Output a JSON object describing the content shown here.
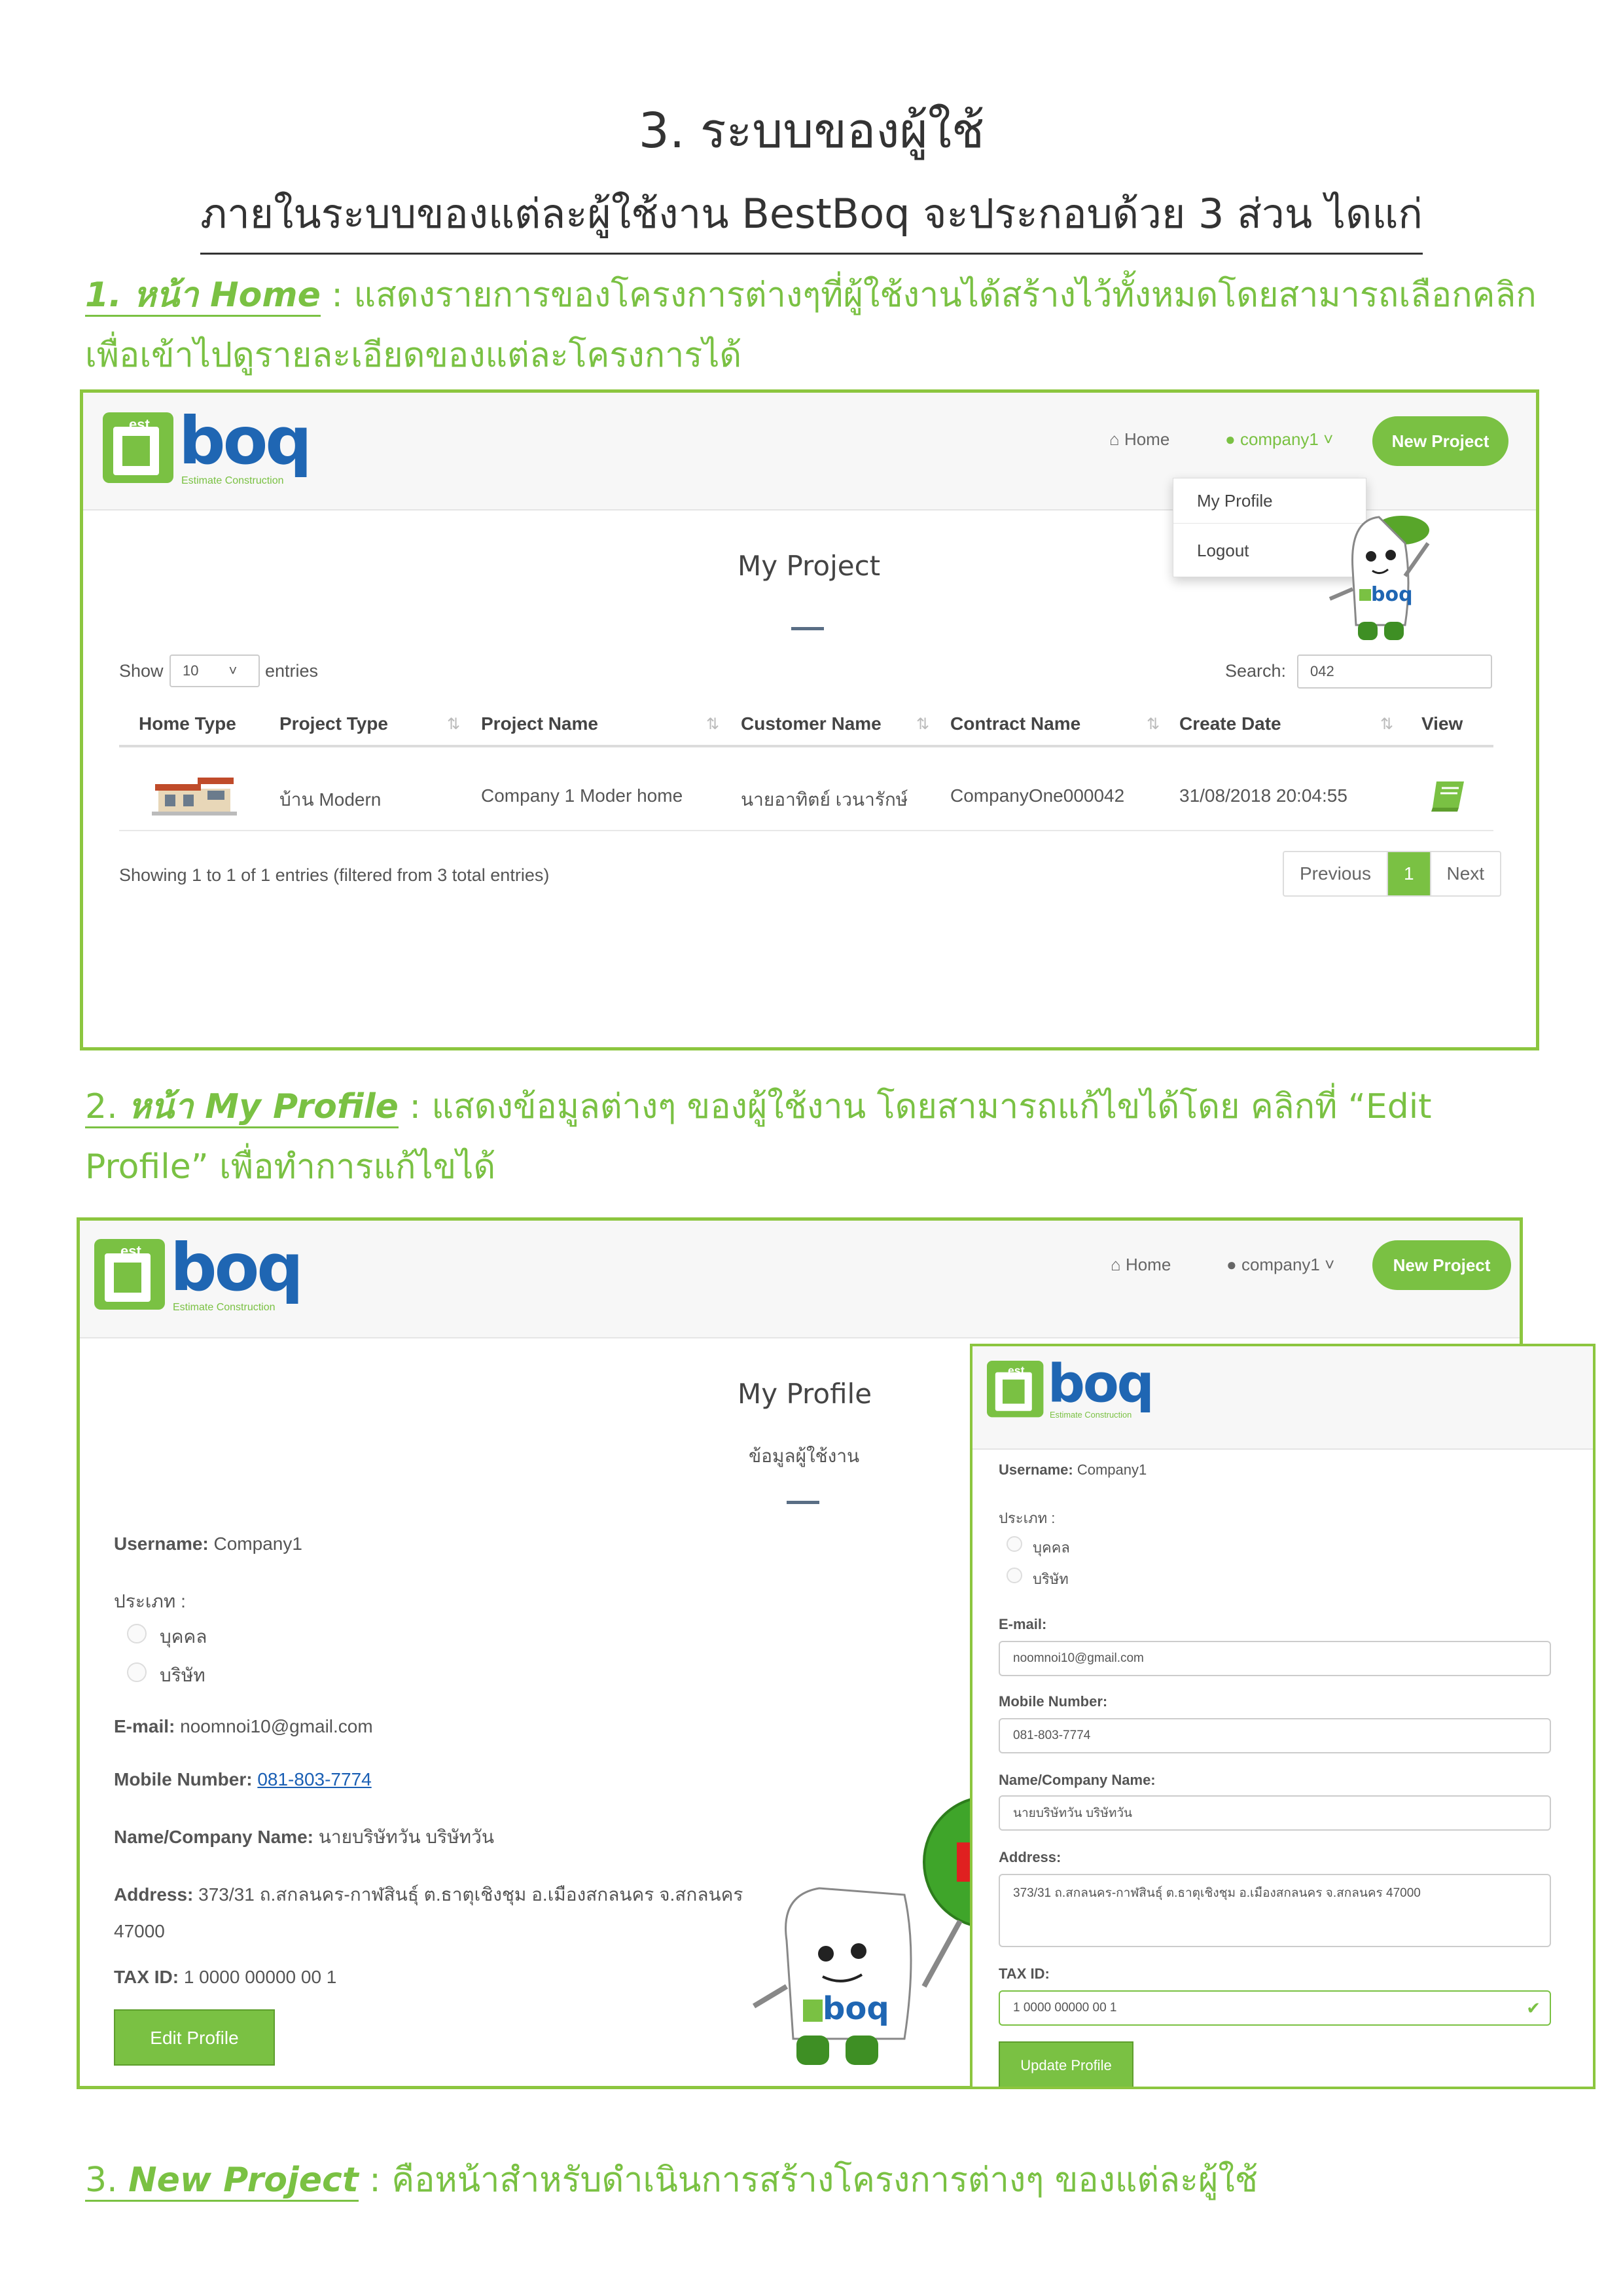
{
  "doc": {
    "title": "3. ระบบของผู้ใช้",
    "subtitle": "ภายในระบบของแต่ละผู้ใช้งาน BestBoq จะประกอบด้วย 3 ส่วน ไดแก่",
    "section1": {
      "lead": "1. หน้า Home",
      "text": " : แสดงรายการของโครงการต่างๆที่ผู้ใช้งานได้สร้างไว้ทั้งหมดโดยสามารถเลือกคลิกเพื่อเข้าไปดูรายละเอียดของแต่ละโครงการได้"
    },
    "section2": {
      "num": "2. ",
      "lead": "หน้า My Profile",
      "text": " : แสดงข้อมูลต่างๆ ของผู้ใช้งาน โดยสามารถแก้ไขได้โดย คลิกที่ “Edit Profile” เพื่อทำการแก้ไขได้"
    },
    "section3": {
      "num": "3. ",
      "lead": "New Project",
      "text": " : คือหน้าสำหรับดำเนินการสร้างโครงการต่างๆ ของแต่ละผู้ใช้"
    }
  },
  "brand": {
    "logo_text": "boq",
    "logo_est": "est",
    "logo_tagline": "Estimate Construction",
    "accent": "#7ac143",
    "blue": "#1f66b3"
  },
  "nav": {
    "home": "Home",
    "user": "company1",
    "new_project": "New Project"
  },
  "dropdown": {
    "profile": "My Profile",
    "logout": "Logout"
  },
  "project_page": {
    "heading": "My Project",
    "show_label": "Show",
    "entries_label": "entries",
    "entries_value": "10",
    "search_label": "Search:",
    "search_value": "042",
    "columns": [
      "Home Type",
      "Project Type",
      "Project Name",
      "Customer Name",
      "Contract Name",
      "Create Date",
      "View"
    ],
    "row": {
      "project_type": "บ้าน Modern",
      "project_name": "Company 1 Moder home",
      "customer_name": "นายอาทิตย์ เวนารักษ์",
      "contract_name": "CompanyOne000042",
      "create_date": "31/08/2018 20:04:55"
    },
    "info": "Showing 1 to 1 of 1 entries (filtered from 3 total entries)",
    "pager": {
      "prev": "Previous",
      "page": "1",
      "next": "Next"
    }
  },
  "profile_page": {
    "heading": "My Profile",
    "sub": "ข้อมูลผู้ใช้งาน",
    "username_label": "Username:",
    "username": "Company1",
    "type_label": "ประเภท :",
    "type_person": "บุคคล",
    "type_company": "บริษัท",
    "email_label": "E-mail:",
    "email": "noomnoi10@gmail.com",
    "mobile_label": "Mobile Number:",
    "mobile": "081-803-7774",
    "name_label": "Name/Company Name:",
    "name": "นายบริษัทวัน บริษัทวัน",
    "address_label": "Address:",
    "address": "373/31 ถ.สกลนคร-กาฬสินธุ์ ต.ธาตุเชิงชุม อ.เมืองสกลนคร จ.สกลนคร 47000",
    "tax_label": "TAX ID:",
    "tax": "1 0000 00000 00 1",
    "edit_button": "Edit Profile",
    "update_button": "Update Profile"
  }
}
